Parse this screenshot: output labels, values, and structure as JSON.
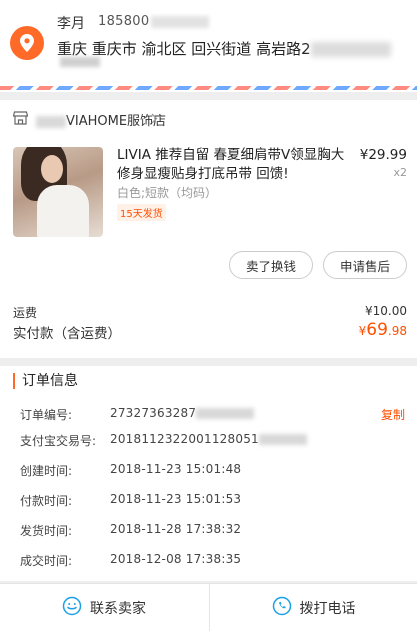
{
  "address": {
    "name": "李月",
    "phone": "185800",
    "line": "重庆 重庆市 渝北区 回兴街道 高岩路2",
    "icon": "location-pin-icon"
  },
  "order": {
    "store_icon": "store-icon",
    "store_name": "VIAHOME服饰店",
    "product": {
      "title": "LIVIA 推荐自留 春夏细肩带V领显胸大修身显瘦贴身打底吊带 回馈!",
      "price": "¥29.99",
      "quantity": "x2",
      "spec": "白色;短款（均码）",
      "tag": "15天发货"
    },
    "buttons": {
      "sell": "卖了换钱",
      "after_sale": "申请售后"
    },
    "shipping": {
      "label": "运费",
      "value": "¥10.00"
    },
    "paid": {
      "label": "实付款（含运费）",
      "currency": "¥",
      "integer": "69",
      "decimal": ".98"
    }
  },
  "info": {
    "title": "订单信息",
    "rows": [
      {
        "key": "订单编号:",
        "value": "27327363287"
      },
      {
        "key": "支付宝交易号:",
        "value": "2018112322001128051"
      },
      {
        "key": "创建时间:",
        "value": "2018-11-23 15:01:48"
      },
      {
        "key": "付款时间:",
        "value": "2018-11-23 15:01:53"
      },
      {
        "key": "发货时间:",
        "value": "2018-11-28 17:38:32"
      },
      {
        "key": "成交时间:",
        "value": "2018-12-08 17:38:35"
      }
    ],
    "copy_label": "复制"
  },
  "footer": {
    "contact_seller": "联系卖家",
    "call_phone": "拨打电话"
  },
  "colors": {
    "accent": "#ff5000",
    "icon_orange": "#ff6a28",
    "link_blue": "#1aa1e5"
  }
}
